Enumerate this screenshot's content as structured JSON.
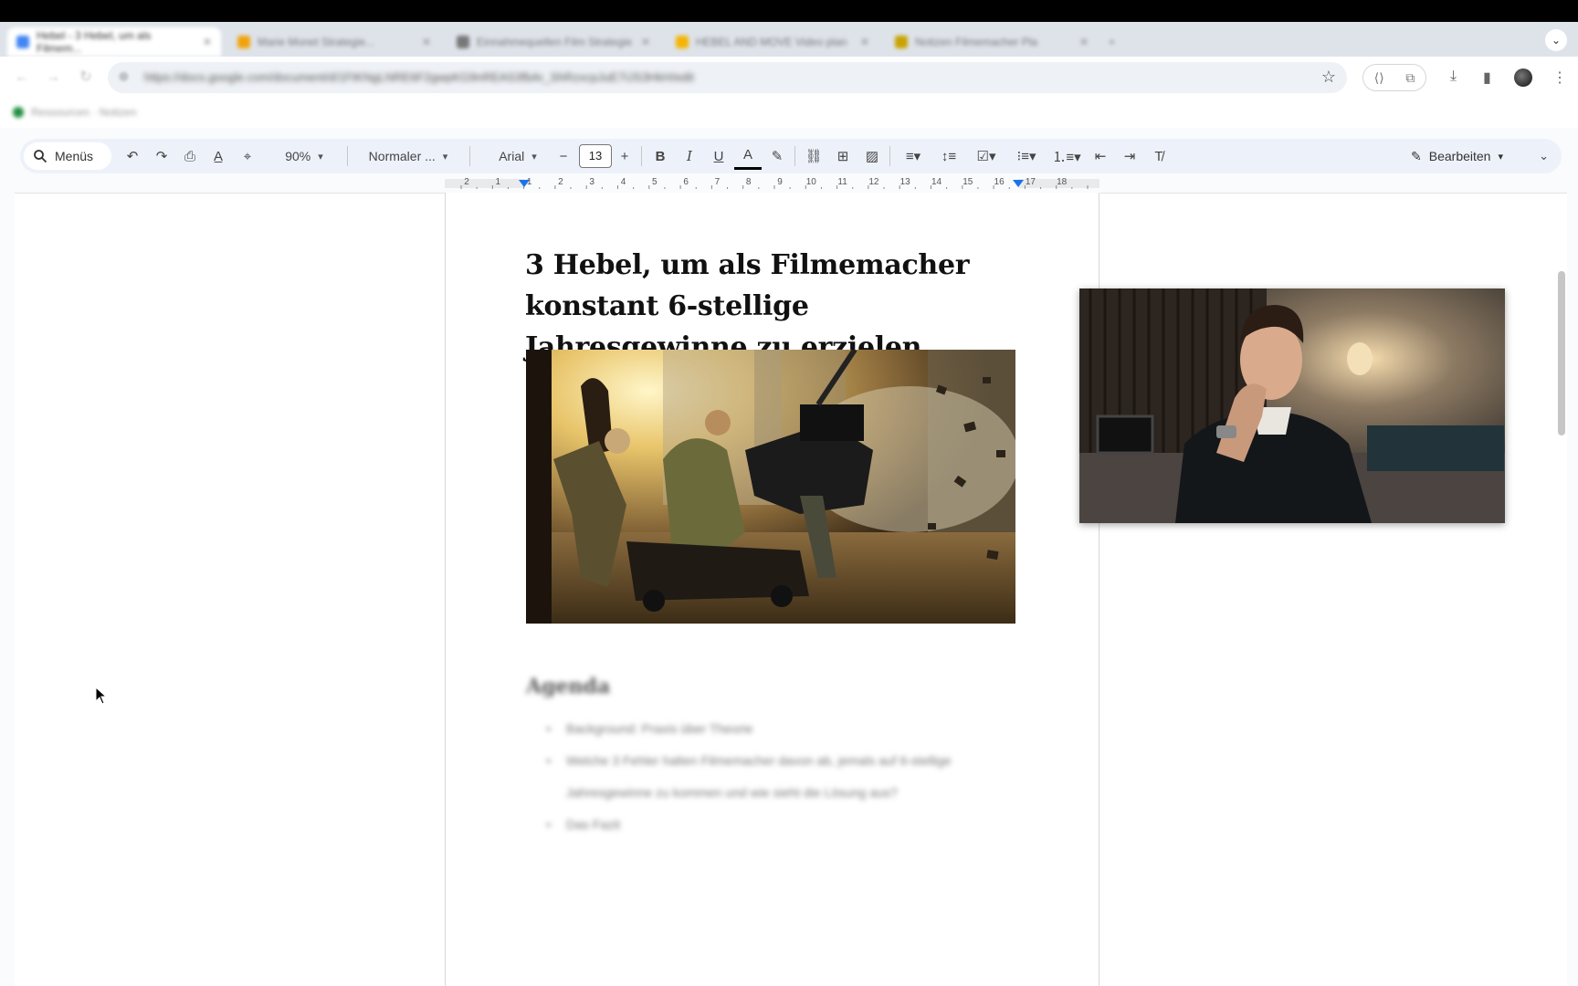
{
  "browser": {
    "tabs": [
      {
        "label": "Hebel - 3 Hebel, um als Filmem...",
        "active": true,
        "color": "#4285f4"
      },
      {
        "label": "Marie Monet Strategie...",
        "active": false,
        "color": "#f0a30a"
      },
      {
        "label": "Einnahmequellen Film Strategie",
        "active": false,
        "color": "#777777"
      },
      {
        "label": "HEBEL AND MOVE Video plan",
        "active": false,
        "color": "#f4b400"
      },
      {
        "label": "Notizen Filmemacher Pla",
        "active": false,
        "color": "#c8a200"
      }
    ],
    "new_tab": "+",
    "url": "https://docs.google.com/document/d/1FtKNgLNRE6F2gwpKG9nREAS3fbAr_ShRzxcpJuE7IJS3HkH/edit",
    "bookmark_label": "Ressourcen · Notizen"
  },
  "toolbar": {
    "menus_label": "Menüs",
    "zoom": "90%",
    "style": "Normaler ...",
    "font": "Arial",
    "font_size": "13",
    "minus": "−",
    "plus": "+",
    "bold": "B",
    "italic": "I",
    "underline": "U",
    "text_color": "A",
    "edit_mode": "Bearbeiten"
  },
  "ruler": {
    "labels": [
      "2",
      "1",
      "1",
      "2",
      "3",
      "4",
      "5",
      "6",
      "7",
      "8",
      "9",
      "10",
      "11",
      "12",
      "13",
      "14",
      "15",
      "16",
      "17",
      "18"
    ]
  },
  "document": {
    "title": "3 Hebel, um als Filmemacher konstant 6-stellige Jahresgewinne zu erzielen",
    "agenda_heading": "Agenda",
    "agenda_items": [
      "Background: Praxis über Theorie",
      "Welche 3 Fehler halten Filmemacher davon ab, jemals auf 6-stellige Jahresgewinne zu kommen und wie sieht die Lösung aus?",
      "Das Fazit"
    ]
  },
  "colors": {
    "accent": "#1a73e8",
    "toolbar_bg": "#edf2fa",
    "page_bg": "#f9fbfd"
  }
}
